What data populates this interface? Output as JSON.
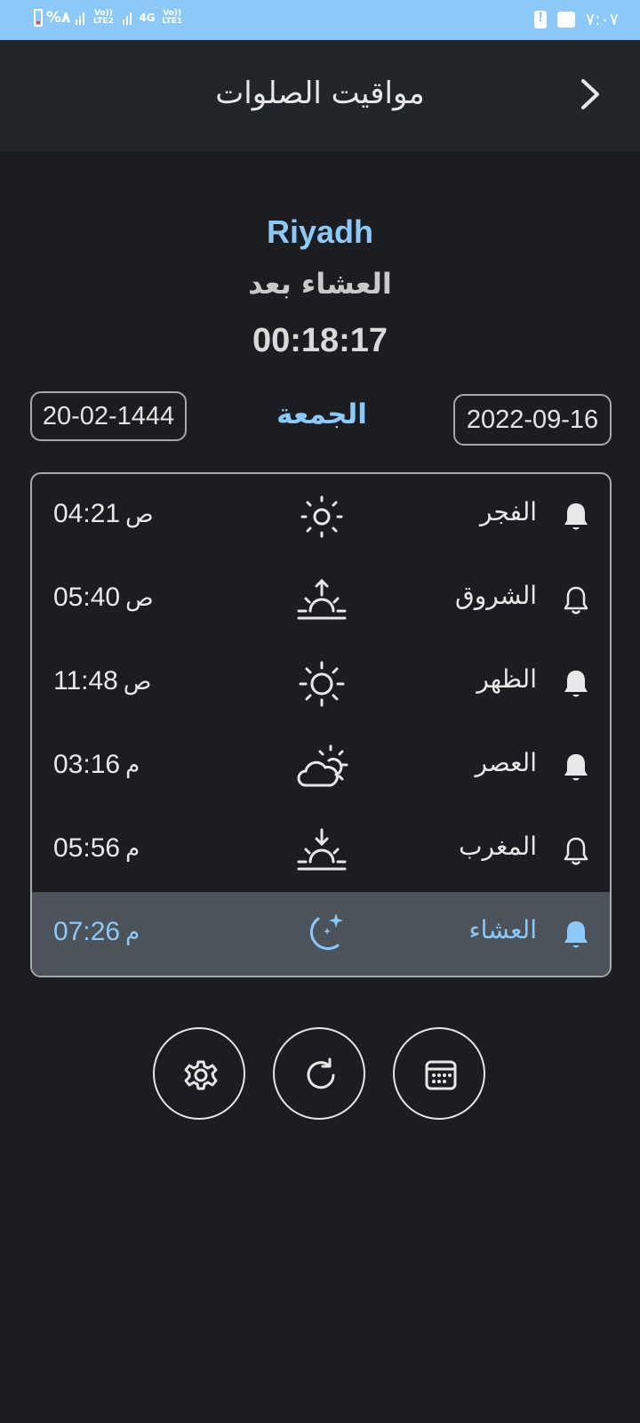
{
  "status_bar": {
    "battery": "%٨",
    "sim2_label": "Vo)) LTE2",
    "network_label": "4G",
    "sim1_label": "Vo)) LTE1",
    "time": "٧:٠٧"
  },
  "appbar": {
    "title": "مواقيت الصلوات",
    "back_icon": "chevron-right-icon"
  },
  "header": {
    "city": "Riyadh",
    "next_prayer_label": "العشاء بعد",
    "countdown": "00:18:17"
  },
  "dates": {
    "hijri": "20-02-1444",
    "day_name": "الجمعة",
    "gregorian": "2022-09-16"
  },
  "prayers": [
    {
      "name": "الفجر",
      "time": "04:21",
      "suffix": "ص",
      "icon": "sun-small-icon",
      "bell": "bell-filled-icon",
      "active": false
    },
    {
      "name": "الشروق",
      "time": "05:40",
      "suffix": "ص",
      "icon": "sunrise-icon",
      "bell": "bell-outline-icon",
      "active": false
    },
    {
      "name": "الظهر",
      "time": "11:48",
      "suffix": "ص",
      "icon": "sun-icon",
      "bell": "bell-filled-icon",
      "active": false
    },
    {
      "name": "العصر",
      "time": "03:16",
      "suffix": "م",
      "icon": "cloud-sun-icon",
      "bell": "bell-filled-icon",
      "active": false
    },
    {
      "name": "المغرب",
      "time": "05:56",
      "suffix": "م",
      "icon": "sunset-icon",
      "bell": "bell-outline-icon",
      "active": false
    },
    {
      "name": "العشاء",
      "time": "07:26",
      "suffix": "م",
      "icon": "moon-stars-icon",
      "bell": "bell-filled-icon",
      "active": true
    }
  ],
  "actions": {
    "settings_icon": "gear-icon",
    "refresh_icon": "refresh-icon",
    "calendar_icon": "calendar-icon"
  },
  "colors": {
    "accent": "#8cc9f9",
    "background": "#1c1d20",
    "appbar": "#22262b",
    "active_row": "#4d535b"
  }
}
